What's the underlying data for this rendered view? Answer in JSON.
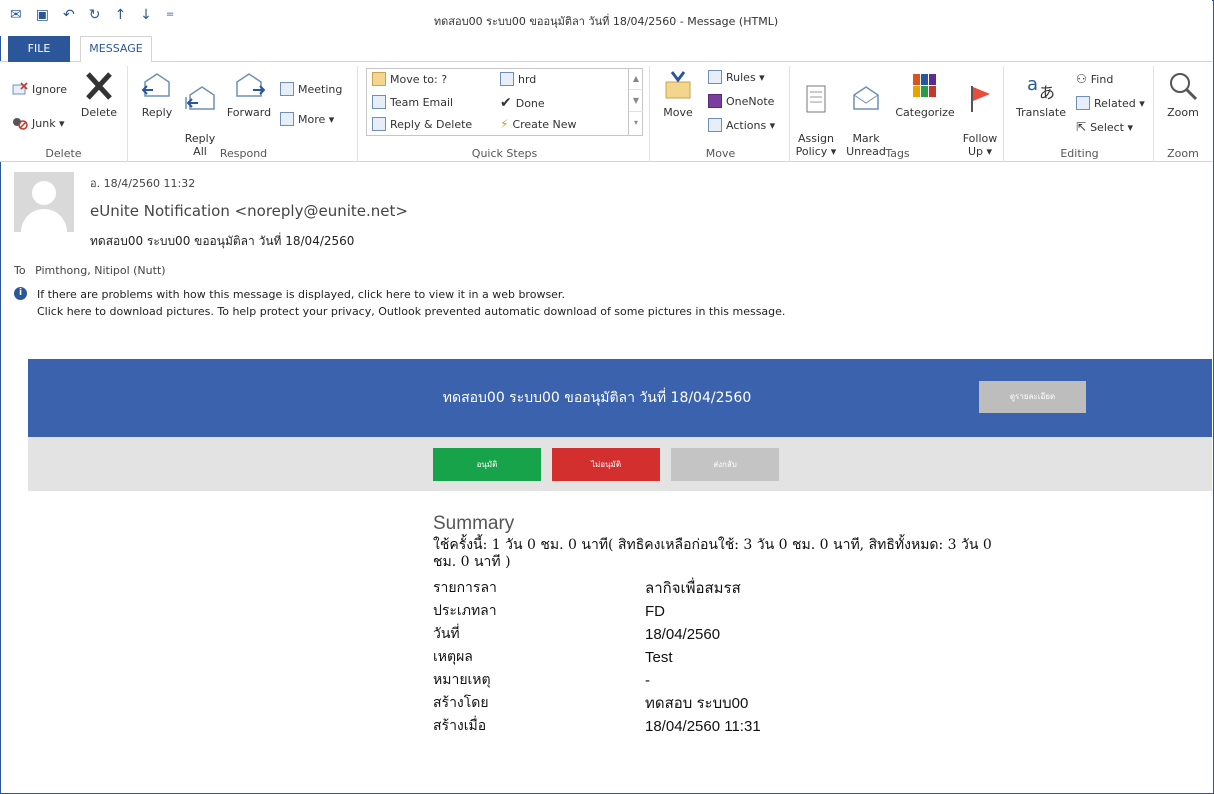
{
  "window": {
    "title": "ทดสอบ00 ระบบ00 ขออนุมัติลา วันที่ 18/04/2560 - Message (HTML)",
    "qat_icons": [
      "mail-icon",
      "save-icon",
      "undo-icon",
      "redo-icon",
      "up-arrow-icon",
      "down-arrow-icon",
      "customize-icon"
    ]
  },
  "tabs": {
    "file": "FILE",
    "message": "MESSAGE"
  },
  "ribbon": {
    "delete_group": {
      "label": "Delete",
      "ignore": "Ignore",
      "junk": "Junk ▾",
      "delete": "Delete"
    },
    "respond_group": {
      "label": "Respond",
      "reply": "Reply",
      "reply_all": "Reply\nAll",
      "forward": "Forward",
      "meeting": "Meeting",
      "more": "More ▾"
    },
    "quick_steps": {
      "label": "Quick Steps",
      "items": [
        "Move to: ?",
        "Team Email",
        "Reply & Delete",
        "hrd",
        "Done",
        "Create New"
      ]
    },
    "move_group": {
      "label": "Move",
      "move": "Move",
      "rules": "Rules ▾",
      "onenote": "OneNote",
      "actions": "Actions ▾"
    },
    "tags_group": {
      "label": "Tags",
      "assign_policy": "Assign\nPolicy ▾",
      "mark_unread": "Mark\nUnread",
      "categorize": "Categorize",
      "follow_up": "Follow\nUp ▾"
    },
    "editing_group": {
      "label": "Editing",
      "translate": "Translate",
      "find": "Find",
      "related": "Related ▾",
      "select": "Select ▾"
    },
    "zoom_group": {
      "label": "Zoom",
      "zoom": "Zoom"
    }
  },
  "header": {
    "date": "อ. 18/4/2560 11:32",
    "from": "eUnite Notification <noreply@eunite.net>",
    "subject": "ทดสอบ00 ระบบ00 ขออนุมัติลา วันที่ 18/04/2560",
    "to_label": "To",
    "to": "Pimthong, Nitipol (Nutt)",
    "info_line1": "If there are problems with how this message is displayed, click here to view it in a web browser.",
    "info_line2": "Click here to download pictures. To help protect your privacy, Outlook prevented automatic download of some pictures in this message."
  },
  "email": {
    "banner_title": "ทดสอบ00 ระบบ00 ขออนุมัติลา วันที่ 18/04/2560",
    "details_button": "ดูรายละเอียด",
    "approve": "อนุมัติ",
    "reject": "ไม่อนุมัติ",
    "return": "ส่งกลับ",
    "summary_title": "Summary",
    "usage": "ใช้ครั้งนี้: 1 วัน 0 ชม. 0 นาที( สิทธิคงเหลือก่อนใช้: 3 วัน 0 ชม. 0 นาที, สิทธิทั้งหมด: 3 วัน 0 ชม. 0 นาที )",
    "rows": [
      {
        "k": "รายการลา",
        "v": "ลากิจเพื่อสมรส"
      },
      {
        "k": "ประเภทลา",
        "v": "FD"
      },
      {
        "k": "วันที่",
        "v": "18/04/2560"
      },
      {
        "k": "เหตุผล",
        "v": "Test"
      },
      {
        "k": "หมายเหตุ",
        "v": "-"
      },
      {
        "k": "สร้างโดย",
        "v": "ทดสอบ ระบบ00"
      },
      {
        "k": "สร้างเมื่อ",
        "v": "18/04/2560 11:31"
      }
    ]
  },
  "colors": {
    "accent": "#2b579a",
    "banner": "#3a62ad",
    "approve": "#17a34a",
    "reject": "#d32f2f",
    "neutral": "#c4c4c4"
  }
}
